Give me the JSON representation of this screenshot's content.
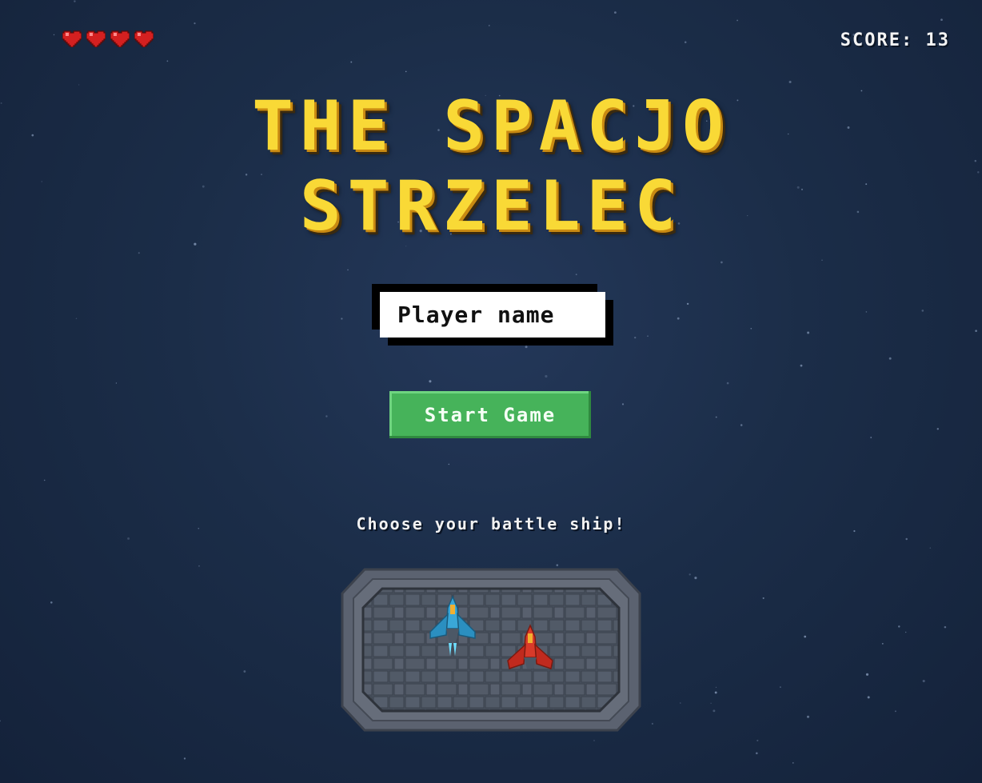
{
  "hud": {
    "lives": 4,
    "score_label": "SCORE:",
    "score_value": "13"
  },
  "title": {
    "line1": "THE SPACJO",
    "line2": "STRZELEC"
  },
  "name_input": {
    "placeholder": "Player name",
    "value": ""
  },
  "start_button": {
    "label": "Start Game"
  },
  "ship_select": {
    "prompt": "Choose your battle ship!",
    "ships": [
      "blue-ship",
      "red-ship"
    ]
  },
  "colors": {
    "title": "#f9d936",
    "start_button": "#46b35a",
    "heart": "#d42020",
    "background": "#1b2d48"
  }
}
